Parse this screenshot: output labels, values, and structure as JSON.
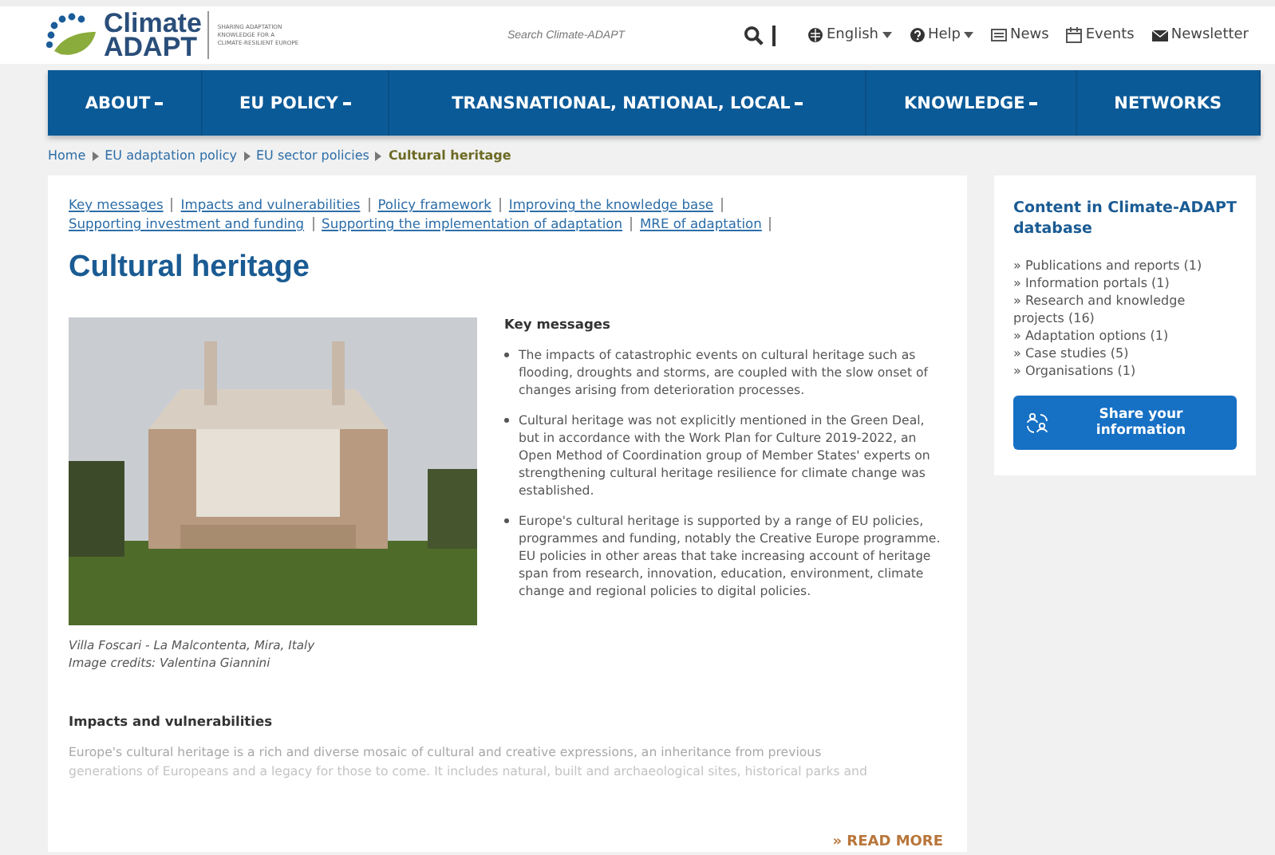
{
  "header": {
    "logo": {
      "word1": "Climate",
      "word2": "ADAPT",
      "tagline": [
        "SHARING ADAPTATION",
        "KNOWLEDGE FOR A",
        "CLIMATE-RESILIENT EUROPE"
      ]
    },
    "search": {
      "placeholder": "Search Climate-ADAPT"
    },
    "links": [
      {
        "kind": "language",
        "label": "English",
        "dropdown": true
      },
      {
        "kind": "help",
        "label": "Help",
        "dropdown": true
      },
      {
        "kind": "news",
        "label": "News",
        "dropdown": false
      },
      {
        "kind": "events",
        "label": "Events",
        "dropdown": false
      },
      {
        "kind": "newsletter",
        "label": "Newsletter",
        "dropdown": false
      }
    ]
  },
  "nav": [
    {
      "label": "ABOUT",
      "dropdown": true
    },
    {
      "label": "EU POLICY",
      "dropdown": true
    },
    {
      "label": "TRANSNATIONAL, NATIONAL, LOCAL",
      "dropdown": true
    },
    {
      "label": "KNOWLEDGE",
      "dropdown": true
    },
    {
      "label": "NETWORKS",
      "dropdown": false
    }
  ],
  "breadcrumb": [
    {
      "label": "Home",
      "current": false
    },
    {
      "label": "EU adaptation policy",
      "current": false
    },
    {
      "label": "EU sector policies",
      "current": false
    },
    {
      "label": "Cultural heritage",
      "current": true
    }
  ],
  "section_links": [
    "Key messages",
    "Impacts and vulnerabilities",
    "Policy framework",
    "Improving the knowledge base",
    "Supporting investment and funding",
    "Supporting the implementation of adaptation",
    "MRE of adaptation"
  ],
  "title": "Cultural heritage",
  "photo": {
    "caption": [
      "Villa Foscari - La Malcontenta, Mira, Italy",
      "Image credits: Valentina Giannini"
    ]
  },
  "key_messages": {
    "heading": "Key messages",
    "bullets": [
      "The impacts of catastrophic events on cultural heritage such as flooding, droughts and storms, are coupled with the slow onset of changes arising from deterioration processes.",
      "Cultural heritage was not explicitly mentioned in the Green Deal, but in accordance with the Work Plan for Culture 2019-2022, an Open Method of Coordination group of Member States' experts on strengthening cultural heritage resilience for climate change was established.",
      "Europe's cultural heritage is supported by a range of EU policies, programmes and funding, notably the Creative Europe programme. EU policies in other areas that take increasing account of heritage span from research, innovation, education, environment, climate change and regional policies to digital policies."
    ]
  },
  "impacts": {
    "heading": "Impacts and vulnerabilities",
    "text": [
      "Europe's cultural heritage is a rich and diverse mosaic of cultural and creative expressions, an inheritance from previous",
      "generations of Europeans and a legacy for those to come. It includes natural, built and archaeological sites, historical parks and"
    ],
    "read_more": "» READ MORE"
  },
  "sidebar": {
    "title": "Content in Climate-ADAPT database",
    "items": [
      "» Publications and reports (1)",
      "» Information portals (1)",
      "» Research and knowledge projects (16)",
      "» Adaptation options (1)",
      "» Case studies (5)",
      "» Organisations (1)"
    ],
    "button": "Share your information"
  }
}
